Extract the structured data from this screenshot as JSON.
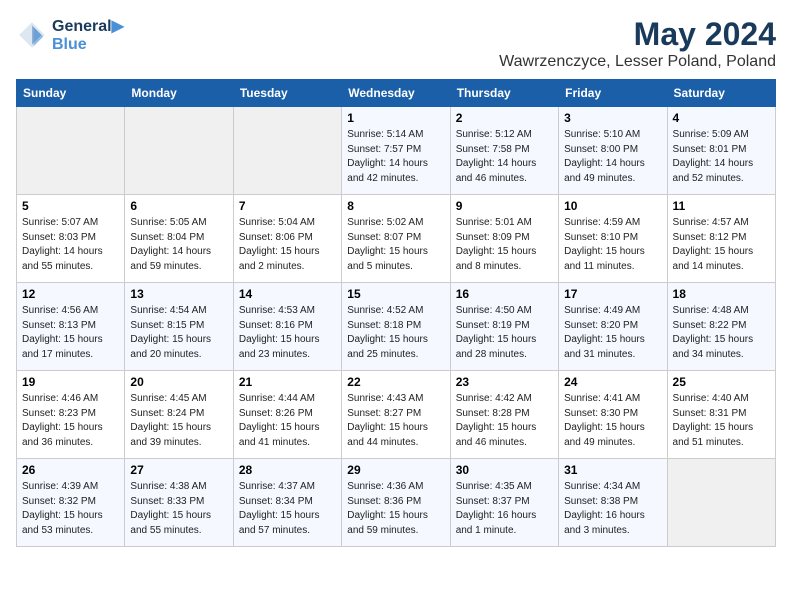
{
  "header": {
    "logo_line1": "General",
    "logo_line2": "Blue",
    "month_year": "May 2024",
    "location": "Wawrzenczyce, Lesser Poland, Poland"
  },
  "weekdays": [
    "Sunday",
    "Monday",
    "Tuesday",
    "Wednesday",
    "Thursday",
    "Friday",
    "Saturday"
  ],
  "weeks": [
    [
      {
        "day": "",
        "info": ""
      },
      {
        "day": "",
        "info": ""
      },
      {
        "day": "",
        "info": ""
      },
      {
        "day": "1",
        "info": "Sunrise: 5:14 AM\nSunset: 7:57 PM\nDaylight: 14 hours\nand 42 minutes."
      },
      {
        "day": "2",
        "info": "Sunrise: 5:12 AM\nSunset: 7:58 PM\nDaylight: 14 hours\nand 46 minutes."
      },
      {
        "day": "3",
        "info": "Sunrise: 5:10 AM\nSunset: 8:00 PM\nDaylight: 14 hours\nand 49 minutes."
      },
      {
        "day": "4",
        "info": "Sunrise: 5:09 AM\nSunset: 8:01 PM\nDaylight: 14 hours\nand 52 minutes."
      }
    ],
    [
      {
        "day": "5",
        "info": "Sunrise: 5:07 AM\nSunset: 8:03 PM\nDaylight: 14 hours\nand 55 minutes."
      },
      {
        "day": "6",
        "info": "Sunrise: 5:05 AM\nSunset: 8:04 PM\nDaylight: 14 hours\nand 59 minutes."
      },
      {
        "day": "7",
        "info": "Sunrise: 5:04 AM\nSunset: 8:06 PM\nDaylight: 15 hours\nand 2 minutes."
      },
      {
        "day": "8",
        "info": "Sunrise: 5:02 AM\nSunset: 8:07 PM\nDaylight: 15 hours\nand 5 minutes."
      },
      {
        "day": "9",
        "info": "Sunrise: 5:01 AM\nSunset: 8:09 PM\nDaylight: 15 hours\nand 8 minutes."
      },
      {
        "day": "10",
        "info": "Sunrise: 4:59 AM\nSunset: 8:10 PM\nDaylight: 15 hours\nand 11 minutes."
      },
      {
        "day": "11",
        "info": "Sunrise: 4:57 AM\nSunset: 8:12 PM\nDaylight: 15 hours\nand 14 minutes."
      }
    ],
    [
      {
        "day": "12",
        "info": "Sunrise: 4:56 AM\nSunset: 8:13 PM\nDaylight: 15 hours\nand 17 minutes."
      },
      {
        "day": "13",
        "info": "Sunrise: 4:54 AM\nSunset: 8:15 PM\nDaylight: 15 hours\nand 20 minutes."
      },
      {
        "day": "14",
        "info": "Sunrise: 4:53 AM\nSunset: 8:16 PM\nDaylight: 15 hours\nand 23 minutes."
      },
      {
        "day": "15",
        "info": "Sunrise: 4:52 AM\nSunset: 8:18 PM\nDaylight: 15 hours\nand 25 minutes."
      },
      {
        "day": "16",
        "info": "Sunrise: 4:50 AM\nSunset: 8:19 PM\nDaylight: 15 hours\nand 28 minutes."
      },
      {
        "day": "17",
        "info": "Sunrise: 4:49 AM\nSunset: 8:20 PM\nDaylight: 15 hours\nand 31 minutes."
      },
      {
        "day": "18",
        "info": "Sunrise: 4:48 AM\nSunset: 8:22 PM\nDaylight: 15 hours\nand 34 minutes."
      }
    ],
    [
      {
        "day": "19",
        "info": "Sunrise: 4:46 AM\nSunset: 8:23 PM\nDaylight: 15 hours\nand 36 minutes."
      },
      {
        "day": "20",
        "info": "Sunrise: 4:45 AM\nSunset: 8:24 PM\nDaylight: 15 hours\nand 39 minutes."
      },
      {
        "day": "21",
        "info": "Sunrise: 4:44 AM\nSunset: 8:26 PM\nDaylight: 15 hours\nand 41 minutes."
      },
      {
        "day": "22",
        "info": "Sunrise: 4:43 AM\nSunset: 8:27 PM\nDaylight: 15 hours\nand 44 minutes."
      },
      {
        "day": "23",
        "info": "Sunrise: 4:42 AM\nSunset: 8:28 PM\nDaylight: 15 hours\nand 46 minutes."
      },
      {
        "day": "24",
        "info": "Sunrise: 4:41 AM\nSunset: 8:30 PM\nDaylight: 15 hours\nand 49 minutes."
      },
      {
        "day": "25",
        "info": "Sunrise: 4:40 AM\nSunset: 8:31 PM\nDaylight: 15 hours\nand 51 minutes."
      }
    ],
    [
      {
        "day": "26",
        "info": "Sunrise: 4:39 AM\nSunset: 8:32 PM\nDaylight: 15 hours\nand 53 minutes."
      },
      {
        "day": "27",
        "info": "Sunrise: 4:38 AM\nSunset: 8:33 PM\nDaylight: 15 hours\nand 55 minutes."
      },
      {
        "day": "28",
        "info": "Sunrise: 4:37 AM\nSunset: 8:34 PM\nDaylight: 15 hours\nand 57 minutes."
      },
      {
        "day": "29",
        "info": "Sunrise: 4:36 AM\nSunset: 8:36 PM\nDaylight: 15 hours\nand 59 minutes."
      },
      {
        "day": "30",
        "info": "Sunrise: 4:35 AM\nSunset: 8:37 PM\nDaylight: 16 hours\nand 1 minute."
      },
      {
        "day": "31",
        "info": "Sunrise: 4:34 AM\nSunset: 8:38 PM\nDaylight: 16 hours\nand 3 minutes."
      },
      {
        "day": "",
        "info": ""
      }
    ]
  ]
}
